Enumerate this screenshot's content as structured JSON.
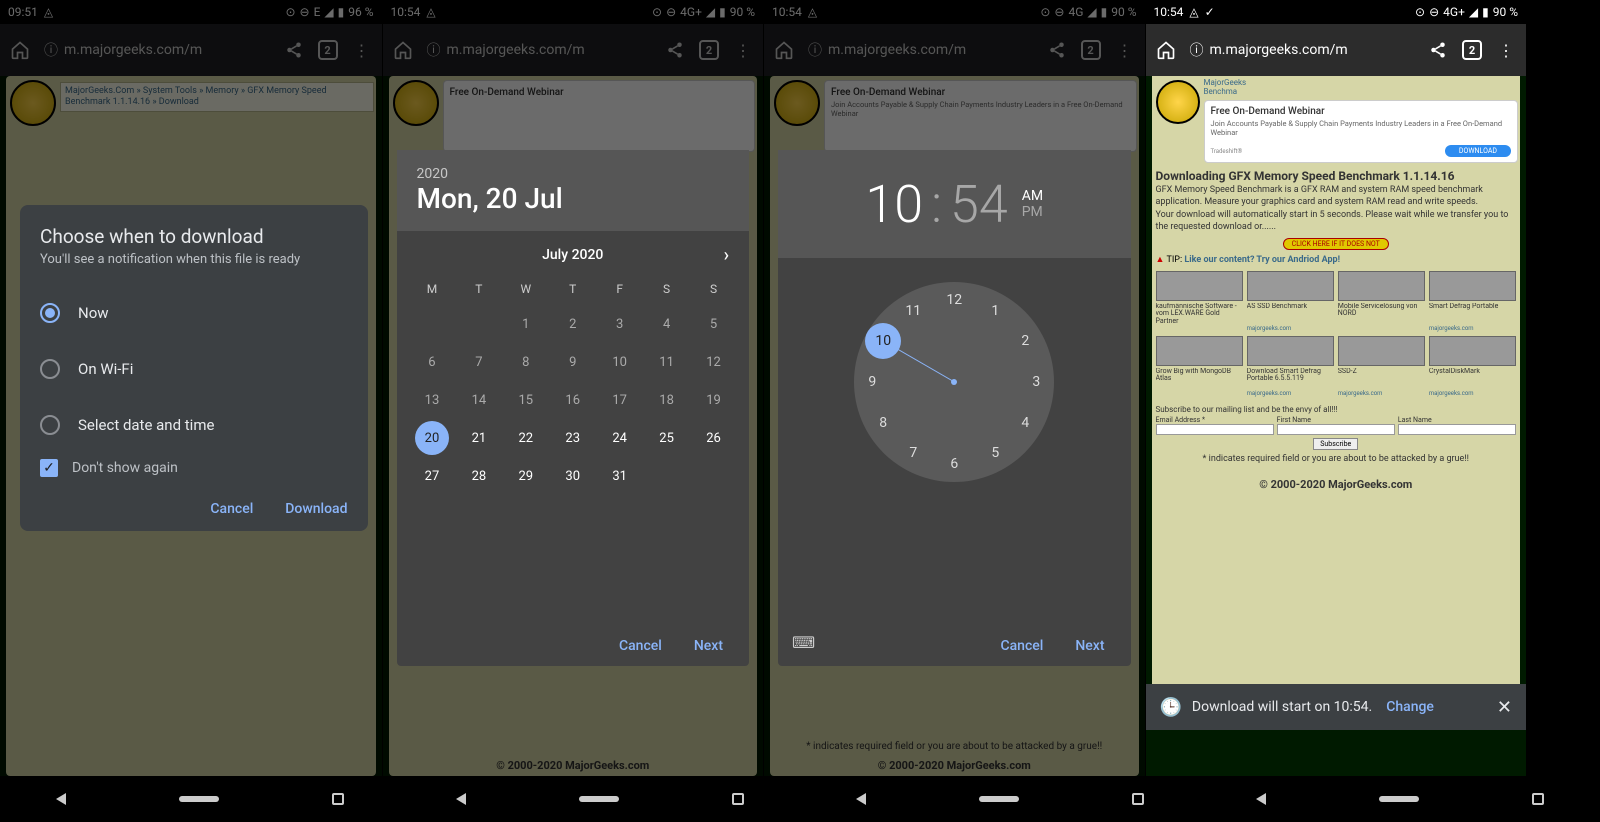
{
  "screens": [
    {
      "status": {
        "time": "09:51",
        "net": "E",
        "signal": "▲",
        "battery": "96 %"
      },
      "browser": {
        "url": "m.majorgeeks.com/m",
        "tabs": "2"
      },
      "page": {
        "breadcrumb": "MajorGeeks.Com » System Tools » Memory » GFX Memory Speed Benchmark 1.1.14.16 » Download"
      },
      "dialog": {
        "title": "Choose when to download",
        "subtitle": "You'll see a notification when this file is ready",
        "options": [
          "Now",
          "On Wi-Fi",
          "Select date and time"
        ],
        "selected": 0,
        "checkbox": "Don't show again",
        "cancel": "Cancel",
        "confirm": "Download"
      }
    },
    {
      "status": {
        "time": "10:54",
        "net": "4G+",
        "signal": "▲",
        "battery": "90 %"
      },
      "browser": {
        "url": "m.majorgeeks.com/m",
        "tabs": "2"
      },
      "ad": {
        "title": "Free On-Demand Webinar"
      },
      "footer": "© 2000-2020 MajorGeeks.com",
      "picker": {
        "year": "2020",
        "date": "Mon, 20 Jul",
        "month": "July 2020",
        "weekdays": [
          "M",
          "T",
          "W",
          "T",
          "F",
          "S",
          "S"
        ],
        "days": [
          1,
          2,
          3,
          4,
          5,
          6,
          7,
          8,
          9,
          10,
          11,
          12,
          13,
          14,
          15,
          16,
          17,
          18,
          19,
          20,
          21,
          22,
          23,
          24,
          25,
          26,
          27,
          28,
          29,
          30,
          31
        ],
        "first_weekday": 2,
        "selected_day": 20,
        "cancel": "Cancel",
        "next": "Next"
      }
    },
    {
      "status": {
        "time": "10:54",
        "net": "4G",
        "signal": "▲",
        "battery": "90 %"
      },
      "browser": {
        "url": "m.majorgeeks.com/m",
        "tabs": "2"
      },
      "ad": {
        "title": "Free On-Demand Webinar",
        "sub": "Join Accounts Payable & Supply Chain Payments Industry Leaders in a Free On-Demand Webinar"
      },
      "footer": "© 2000-2020 MajorGeeks.com",
      "grue": "* indicates required field or you are about to be attacked by a grue!!",
      "timepicker": {
        "hour": "10",
        "sep": ":",
        "minute": "54",
        "am": "AM",
        "pm": "PM",
        "selected_hour": 10,
        "cancel": "Cancel",
        "next": "Next"
      }
    },
    {
      "status": {
        "time": "10:54",
        "net": "4G+",
        "signal": "▲",
        "battery": "90 %",
        "check": true
      },
      "browser": {
        "url": "m.majorgeeks.com/m",
        "tabs": "2"
      },
      "ad": {
        "title": "Free On-Demand Webinar",
        "sub": "Join Accounts Payable & Supply Chain Payments Industry Leaders in a Free On-Demand Webinar",
        "btn": "DOWNLOAD"
      },
      "breadcrumb_short": "MajorGeeks\nBenchma",
      "heading": "Downloading GFX Memory Speed Benchmark 1.1.14.16",
      "desc": "GFX Memory Speed Benchmark is a GFX RAM and system RAM speed benchmark application. Measure your graphics card and system RAM read and write speeds.",
      "auto": "Your download will automatically start in 5 seconds. Please wait while we transfer you to the requested download or......",
      "click_here": "CLICK HERE IF IT DOES NOT",
      "tip_prefix": "TIP: ",
      "tip_link": "Like our content? Try our Andriod App!",
      "thumbs": [
        {
          "cap": "kaufmännische Software - vom LEX.WARE Gold Partner",
          "src": ""
        },
        {
          "cap": "AS SSD Benchmark",
          "src": "majorgeeks.com"
        },
        {
          "cap": "Mobile Servicelösung von NORD",
          "src": ""
        },
        {
          "cap": "Smart Defrag Portable",
          "src": "majorgeeks.com"
        },
        {
          "cap": "Grow Big with MongoDB Atlas",
          "src": ""
        },
        {
          "cap": "Download Smart Defrag Portable 6.5.5.119",
          "src": "majorgeeks.com"
        },
        {
          "cap": "SSD-Z",
          "src": "majorgeeks.com"
        },
        {
          "cap": "CrystalDiskMark",
          "src": "majorgeeks.com"
        }
      ],
      "sub_text": "Subscribe to our mailing list and be the envy of all!!!",
      "fields": [
        "Email Address *",
        "First Name",
        "Last Name"
      ],
      "subscribe": "Subscribe",
      "grue": "* indicates required field or you are about to be attacked by a grue!!",
      "footer": "© 2000-2020 MajorGeeks.com",
      "snackbar": {
        "text": "Download will start on 10:54.",
        "change": "Change"
      }
    }
  ]
}
